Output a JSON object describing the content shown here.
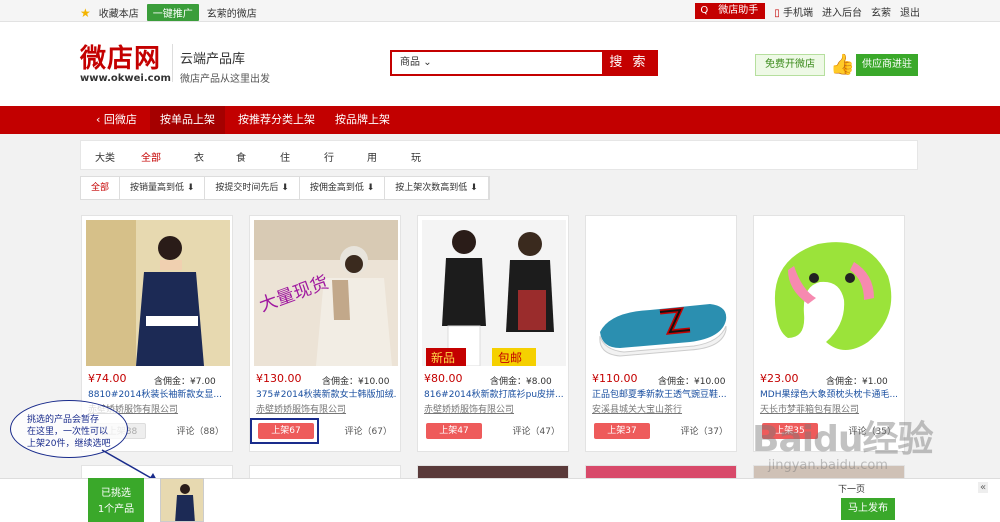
{
  "topbar": {
    "favorite": "收藏本店",
    "promote": "一键推广",
    "my_shop": "玄萦的微店",
    "helper": "微店助手",
    "mobile": "手机端",
    "backend": "进入后台",
    "username": "玄萦",
    "logout": "退出"
  },
  "header": {
    "logo_cn": "微店网",
    "logo_url": "www.okwei.com",
    "slogan_title": "云端产品库",
    "slogan_sub": "微店产品从这里出发",
    "search_category": "商品",
    "search_value": "",
    "search_button": "搜 索",
    "free_shop": "免费开微店",
    "supplier": "供应商进驻"
  },
  "nav": {
    "back": "回微店",
    "tabs": [
      "按单品上架",
      "按推荐分类上架",
      "按品牌上架"
    ]
  },
  "categories": {
    "label": "大类",
    "items": [
      "全部",
      "衣",
      "食",
      "住",
      "行",
      "用",
      "玩"
    ]
  },
  "sorts": [
    "全部",
    "按销量高到低 ⬇",
    "按提交时间先后 ⬇",
    "按佣金高到低 ⬇",
    "按上架次数高到低 ⬇"
  ],
  "products": [
    {
      "price": "¥74.00",
      "commission": "含佣金：¥7.00",
      "title": "8810#2014秋装长袖新款女显...",
      "company": "赤壁娇娇服饰有限公司",
      "shelf": "已上架88",
      "review": "评论（88）"
    },
    {
      "price": "¥130.00",
      "commission": "含佣金：¥10.00",
      "title": "375#2014秋装新款女士韩版加绒...",
      "company": "赤壁娇娇服饰有限公司",
      "shelf": "上架67",
      "review": "评论（67）"
    },
    {
      "price": "¥80.00",
      "commission": "含佣金：¥8.00",
      "title": "816#2014秋新款打底衫pu皮拼...",
      "company": "赤壁娇娇服饰有限公司",
      "shelf": "上架47",
      "review": "评论（47）"
    },
    {
      "price": "¥110.00",
      "commission": "含佣金：¥10.00",
      "title": "正品包邮夏季新款王透气豌豆鞋...",
      "company": "安溪县城关大宝山茶行",
      "shelf": "上架37",
      "review": "评论（37）"
    },
    {
      "price": "¥23.00",
      "commission": "含佣金：¥1.00",
      "title": "MDH果绿色大象颈枕头枕卡通毛...",
      "company": "天长市梦菲箱包有限公司",
      "shelf": "上架35",
      "review": "评论（35）"
    }
  ],
  "callout": [
    "挑选的产品会暂存",
    "在这里，一次性可以",
    "上架20件，继续选吧"
  ],
  "img_text": {
    "big_promo": "大量现货",
    "new_prefix": "新品",
    "baoyou": "包邮"
  },
  "bottom": {
    "picked_line1": "已挑选",
    "picked_line2": "1个产品",
    "publish": "马上发布",
    "next_page": "下一页"
  },
  "watermark": {
    "main": "Baidu经验",
    "sub": "jingyan.baidu.com"
  },
  "colors": {
    "brand_red": "#c20000",
    "green": "#3aa82a"
  }
}
